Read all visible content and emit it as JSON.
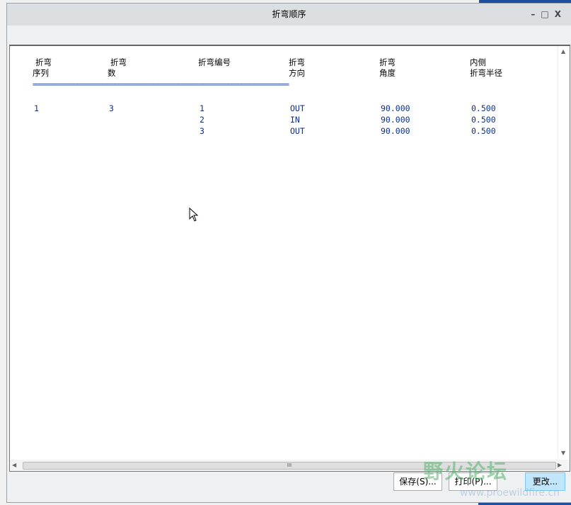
{
  "window": {
    "title": "折弯顺序"
  },
  "headers": [
    {
      "line1": "折弯",
      "line2": "序列"
    },
    {
      "line1": "折弯",
      "line2": "数"
    },
    {
      "line1": "折弯编号",
      "line2": ""
    },
    {
      "line1": "折弯",
      "line2": "方向"
    },
    {
      "line1": "折弯",
      "line2": "角度"
    },
    {
      "line1": "内侧",
      "line2": "折弯半径"
    }
  ],
  "separator": "=================================================================================",
  "rows": [
    {
      "seq": "1",
      "count": "3",
      "num": "1",
      "dir": "OUT",
      "angle": "90.000",
      "radius": "0.500"
    },
    {
      "seq": "",
      "count": "",
      "num": "2",
      "dir": "IN",
      "angle": "90.000",
      "radius": "0.500"
    },
    {
      "seq": "",
      "count": "",
      "num": "3",
      "dir": "OUT",
      "angle": "90.000",
      "radius": "0.500"
    }
  ],
  "buttons": {
    "save": "保存(S)...",
    "print": "打印(P)...",
    "modify": "更改..."
  },
  "scroll_grip": "III",
  "watermark": {
    "text": "野火论坛",
    "url": "www.proewildfire.cn"
  }
}
